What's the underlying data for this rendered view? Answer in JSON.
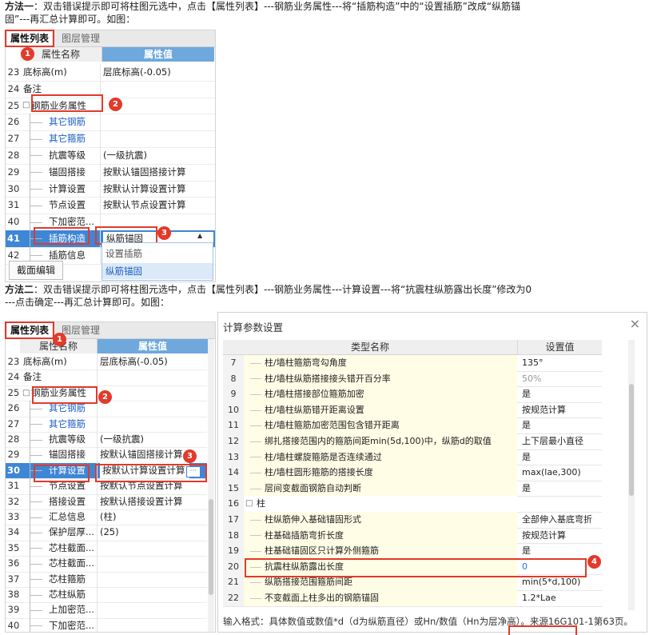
{
  "method1": {
    "line1_bold": "方法一",
    "line1": "：双击错误提示即可将柱图元选中，点击【属性列表】---钢筋业务属性---将“插筋构造”中的“设置插筋”改成“纵筋锚",
    "line2": "固”---再汇总计算即可。如图："
  },
  "method2": {
    "line1_bold": "方法二",
    "line1": "：双击错误提示即可将柱图元选中，点击【属性列表】---钢筋业务属性---计算设置---将“抗震柱纵筋露出长度”修改为0",
    "line2": "---点击确定---再汇总计算即可。如图："
  },
  "panel1": {
    "tab_active": "属性列表",
    "tab_inactive": "图层管理",
    "header_name": "属性名称",
    "header_value": "属性值",
    "rows": [
      {
        "num": "23",
        "name": "底标高(m)",
        "value": "层底标高(-0.05)"
      },
      {
        "num": "24",
        "name": "备注",
        "value": ""
      },
      {
        "num": "25",
        "name": "钢筋业务属性",
        "value": ""
      },
      {
        "num": "26",
        "name": "其它钢筋",
        "value": ""
      },
      {
        "num": "27",
        "name": "其它箍筋",
        "value": ""
      },
      {
        "num": "28",
        "name": "抗震等级",
        "value": "(一级抗震)"
      },
      {
        "num": "29",
        "name": "锚固搭接",
        "value": "按默认锚固搭接计算"
      },
      {
        "num": "30",
        "name": "计算设置",
        "value": "按默认计算设置计算"
      },
      {
        "num": "31",
        "name": "节点设置",
        "value": "按默认节点设置计算"
      },
      {
        "num": "40",
        "name": "下加密范...",
        "value": ""
      },
      {
        "num": "41",
        "name": "插筋构造",
        "value": "纵筋锚固"
      },
      {
        "num": "42",
        "name": "插筋信息",
        "value": ""
      }
    ],
    "row25_prefix": "□",
    "dropdown_options": [
      "设置插筋",
      "纵筋锚固"
    ],
    "section_button": "截面编辑",
    "badges": [
      "1",
      "2",
      "3"
    ]
  },
  "panel2": {
    "tab_active": "属性列表",
    "tab_inactive": "图层管理",
    "header_name": "属性名称",
    "header_value": "属性值",
    "rows": [
      {
        "num": "23",
        "name": "底标高(m)",
        "value": "层底标高(-0.05)"
      },
      {
        "num": "24",
        "name": "备注",
        "value": ""
      },
      {
        "num": "25",
        "name": "钢筋业务属性",
        "value": ""
      },
      {
        "num": "26",
        "name": "其它钢筋",
        "value": ""
      },
      {
        "num": "27",
        "name": "其它箍筋",
        "value": ""
      },
      {
        "num": "28",
        "name": "抗震等级",
        "value": "(一级抗震)"
      },
      {
        "num": "29",
        "name": "锚固搭接",
        "value": "按默认锚固搭接计算"
      },
      {
        "num": "30",
        "name": "计算设置",
        "value": "按默认计算设置计算"
      },
      {
        "num": "31",
        "name": "节点设置",
        "value": "按默认节点设置计算"
      },
      {
        "num": "32",
        "name": "搭接设置",
        "value": "按默认搭接设置计算"
      },
      {
        "num": "33",
        "name": "汇总信息",
        "value": "(柱)"
      },
      {
        "num": "34",
        "name": "保护层厚...",
        "value": "(25)"
      },
      {
        "num": "35",
        "name": "芯柱截面...",
        "value": ""
      },
      {
        "num": "36",
        "name": "芯柱截面...",
        "value": ""
      },
      {
        "num": "37",
        "name": "芯柱箍筋",
        "value": ""
      },
      {
        "num": "38",
        "name": "芯柱纵筋",
        "value": ""
      },
      {
        "num": "39",
        "name": "上加密范...",
        "value": ""
      },
      {
        "num": "40",
        "name": "下加密范...",
        "value": ""
      }
    ],
    "row25_prefix": "□",
    "ellipsis_button": "···",
    "badges": [
      "1",
      "2",
      "3"
    ]
  },
  "dialog": {
    "title": "计算参数设置",
    "close": "×",
    "header_name": "类型名称",
    "header_value": "设置值",
    "rows": [
      {
        "num": "7",
        "name": "柱/墙柱箍筋弯勾角度",
        "value": "135°"
      },
      {
        "num": "8",
        "name": "柱/墙柱纵筋搭接接头错开百分率",
        "value": "50%"
      },
      {
        "num": "9",
        "name": "柱/墙柱搭接部位箍筋加密",
        "value": "是"
      },
      {
        "num": "10",
        "name": "柱/墙柱纵筋错开距离设置",
        "value": "按规范计算"
      },
      {
        "num": "11",
        "name": "柱/墙柱箍筋加密范围包含错开距离",
        "value": "是"
      },
      {
        "num": "12",
        "name": "绑扎搭接范围内的箍筋间距min(5d,100)中，纵筋d的取值",
        "value": "上下层最小直径"
      },
      {
        "num": "13",
        "name": "柱/墙柱螺旋箍筋是否连续通过",
        "value": "是"
      },
      {
        "num": "14",
        "name": "柱/墙柱圆形箍筋的搭接长度",
        "value": "max(lae,300)"
      },
      {
        "num": "15",
        "name": "层间变截面钢筋自动判断",
        "value": "是"
      },
      {
        "num": "16",
        "name": "柱",
        "value": ""
      },
      {
        "num": "17",
        "name": "柱纵筋伸入基础锚固形式",
        "value": "全部伸入基底弯折"
      },
      {
        "num": "18",
        "name": "柱基础插筋弯折长度",
        "value": "按规范计算"
      },
      {
        "num": "19",
        "name": "柱基础锚固区只计算外侧箍筋",
        "value": "是"
      },
      {
        "num": "20",
        "name": "抗震柱纵筋露出长度",
        "value": "0"
      },
      {
        "num": "21",
        "name": "纵筋搭接范围箍筋间距",
        "value": "min(5*d,100)"
      },
      {
        "num": "22",
        "name": "不变截面上柱多出的钢筋锚固",
        "value": "1.2*Lae"
      }
    ],
    "row16_prefix": "□",
    "footer": "输入格式：具体数值或数值*d（d为纵筋直径）或Hn/数值（Hn为层净高）。来源16G101-1第63页。",
    "badge": "4"
  },
  "colors": {
    "accent": "#3e86d6",
    "highlight": "#e23a2b",
    "header_blue": "#6fa8dc"
  }
}
